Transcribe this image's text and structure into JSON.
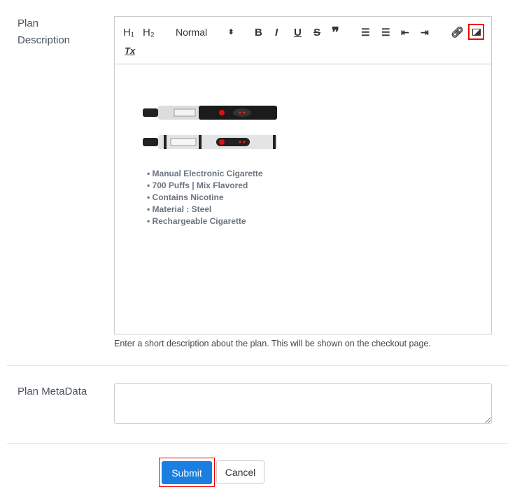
{
  "plan_description": {
    "label_line1": "Plan",
    "label_line2": "Description",
    "toolbar": {
      "h1": "H₁",
      "h2": "H₂",
      "format_select": "Normal",
      "bold": "B",
      "italic": "I",
      "underline": "U",
      "strike": "S",
      "quote": "❞",
      "clear_format": "Tx"
    },
    "content_bullets": [
      "Manual Electronic Cigarette",
      "700 Puffs | Mix Flavored",
      "Contains Nicotine",
      "Material : Steel",
      "Rechargeable Cigarette"
    ],
    "help_text": "Enter a short description about the plan. This will be shown on the checkout page."
  },
  "plan_metadata": {
    "label": "Plan MetaData",
    "value": ""
  },
  "actions": {
    "submit": "Submit",
    "cancel": "Cancel"
  },
  "colors": {
    "primary": "#1a7fe0",
    "highlight": "#e00000"
  }
}
